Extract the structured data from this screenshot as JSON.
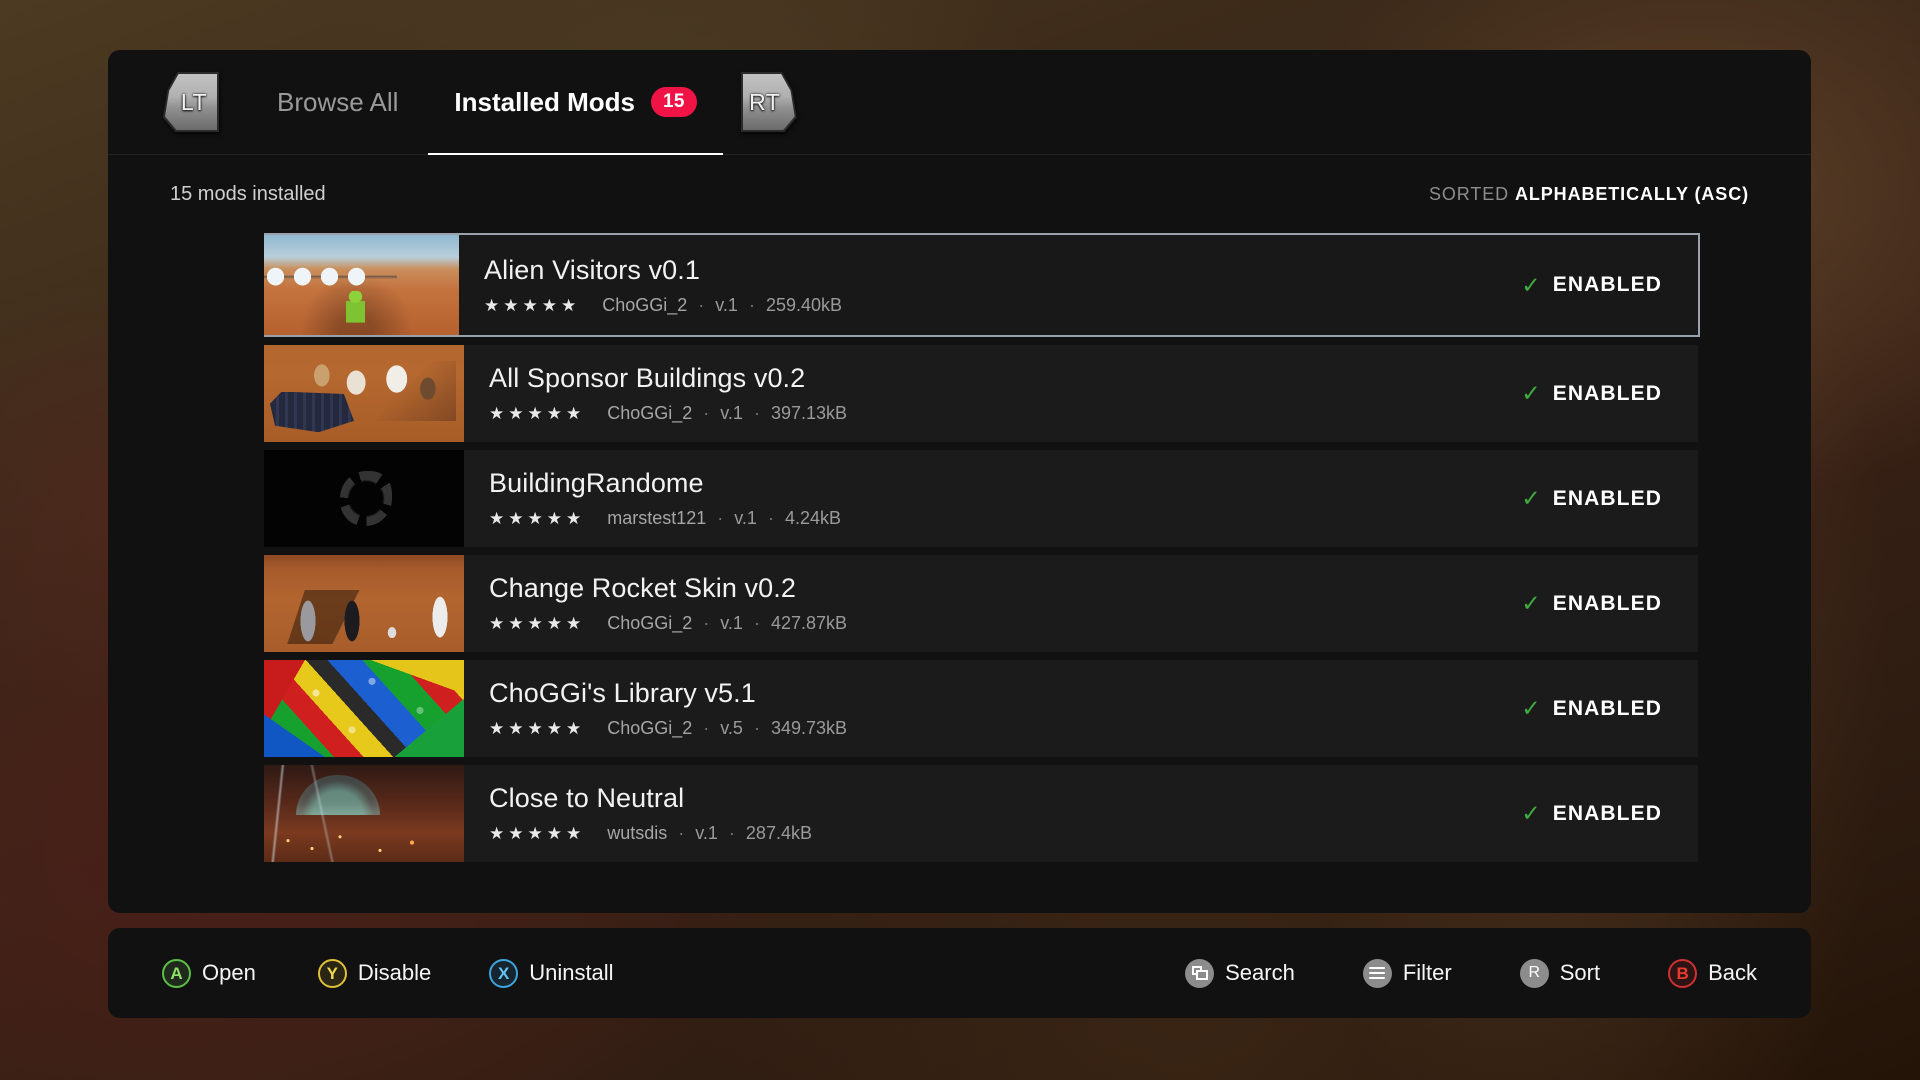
{
  "header": {
    "shoulder_left": "LT",
    "shoulder_right": "RT",
    "tabs": [
      {
        "label": "Browse All",
        "active": false
      },
      {
        "label": "Installed Mods",
        "active": true,
        "badge": "15"
      }
    ]
  },
  "subheader": {
    "installed_count": "15 mods installed",
    "sorted_label": "SORTED ",
    "sorted_value": "ALPHABETICALLY (ASC)"
  },
  "mods": [
    {
      "title": "Alien Visitors v0.1",
      "stars": "★★★★★",
      "author": "ChoGGi_2",
      "version": "v.1",
      "size": "259.40kB",
      "status": "ENABLED",
      "selected": true
    },
    {
      "title": "All Sponsor Buildings v0.2",
      "stars": "★★★★★",
      "author": "ChoGGi_2",
      "version": "v.1",
      "size": "397.13kB",
      "status": "ENABLED",
      "selected": false
    },
    {
      "title": "BuildingRandome",
      "stars": "★★★★★",
      "author": "marstest121",
      "version": "v.1",
      "size": "4.24kB",
      "status": "ENABLED",
      "selected": false
    },
    {
      "title": "Change Rocket Skin v0.2",
      "stars": "★★★★★",
      "author": "ChoGGi_2",
      "version": "v.1",
      "size": "427.87kB",
      "status": "ENABLED",
      "selected": false
    },
    {
      "title": "ChoGGi's Library v5.1",
      "stars": "★★★★★",
      "author": "ChoGGi_2",
      "version": "v.5",
      "size": "349.73kB",
      "status": "ENABLED",
      "selected": false
    },
    {
      "title": "Close to Neutral",
      "stars": "★★★★★",
      "author": "wutsdis",
      "version": "v.1",
      "size": "287.4kB",
      "status": "ENABLED",
      "selected": false
    }
  ],
  "separator": "·",
  "check_glyph": "✓",
  "actions": {
    "left": [
      {
        "key": "A",
        "label": "Open",
        "icon": "button-a-icon"
      },
      {
        "key": "Y",
        "label": "Disable",
        "icon": "button-y-icon"
      },
      {
        "key": "X",
        "label": "Uninstall",
        "icon": "button-x-icon"
      }
    ],
    "right": [
      {
        "key": "",
        "label": "Search",
        "icon": "windows-icon"
      },
      {
        "key": "",
        "label": "Filter",
        "icon": "hamburger-icon"
      },
      {
        "key": "R",
        "label": "Sort",
        "icon": "button-r-icon"
      },
      {
        "key": "B",
        "label": "Back",
        "icon": "button-b-icon"
      }
    ]
  },
  "colors": {
    "badge": "#f01446",
    "enabled_check": "#3fae3f",
    "button_a": "#5bbf46",
    "button_y": "#e0c136",
    "button_x": "#3ea5dc",
    "button_b": "#d03030",
    "scrollbar": "#4c5663"
  }
}
